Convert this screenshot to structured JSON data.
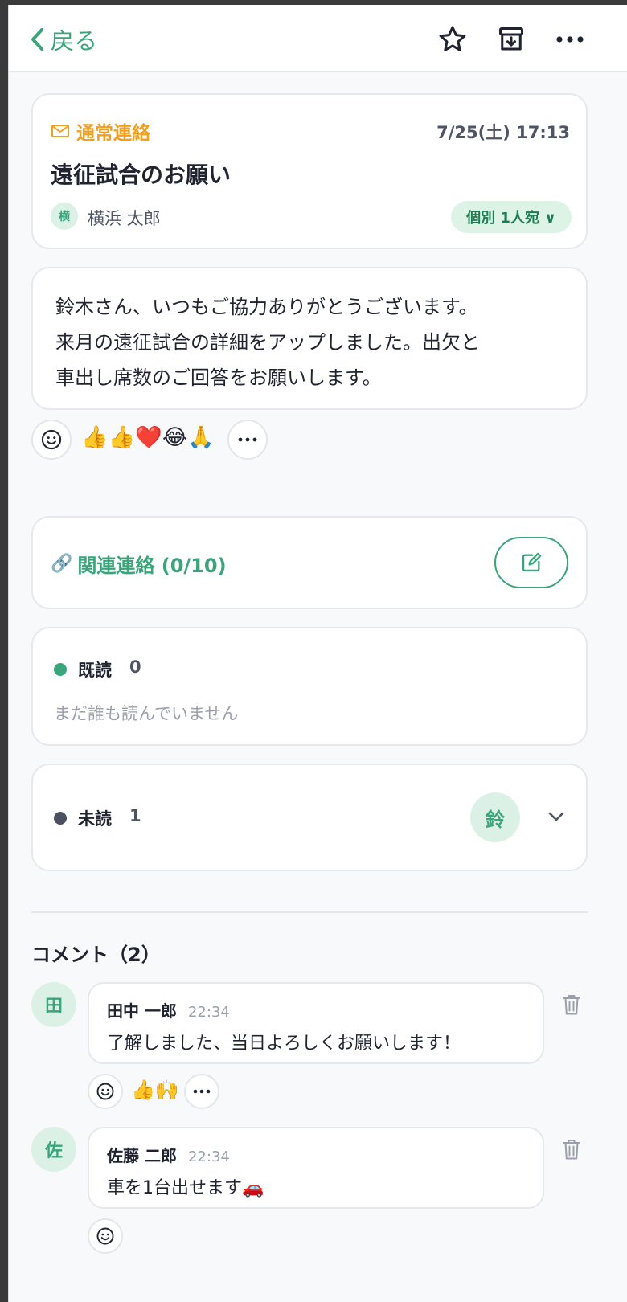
{
  "header": {
    "back_label": "戻る"
  },
  "message": {
    "category": "通常連絡",
    "datetime": "7/25(土) 17:13",
    "title": "遠征試合のお願い",
    "sender_initial": "横",
    "sender_name": "横浜 太郎",
    "recipient_badge": "個別 1人宛 ∨",
    "body_lines": [
      "鈴木さん、いつもご協力ありがとうございます。",
      "来月の遠征試合の詳細をアップしました。出欠と",
      "車出し席数のご回答をお願いします。"
    ],
    "reactions": "👍👍❤️😂🙏"
  },
  "related": {
    "label": "関連連絡 (0/10)",
    "link_icon": "🔗"
  },
  "read": {
    "label": "既読",
    "count": "0",
    "empty_text": "まだ誰も読んでいません",
    "dot_color": "#3aa57a"
  },
  "unread": {
    "label": "未読",
    "count": "1",
    "avatar_initial": "鈴",
    "dot_color": "#4a5060"
  },
  "comments": {
    "heading": "コメント（2）",
    "items": [
      {
        "initial": "田",
        "author": "田中 一郎",
        "time": "22:34",
        "text": "了解しました、当日よろしくお願いします！",
        "reactions": "👍🙌"
      },
      {
        "initial": "佐",
        "author": "佐藤 二郎",
        "time": "22:34",
        "text": "車を1台出せます🚗",
        "reactions": ""
      }
    ]
  }
}
